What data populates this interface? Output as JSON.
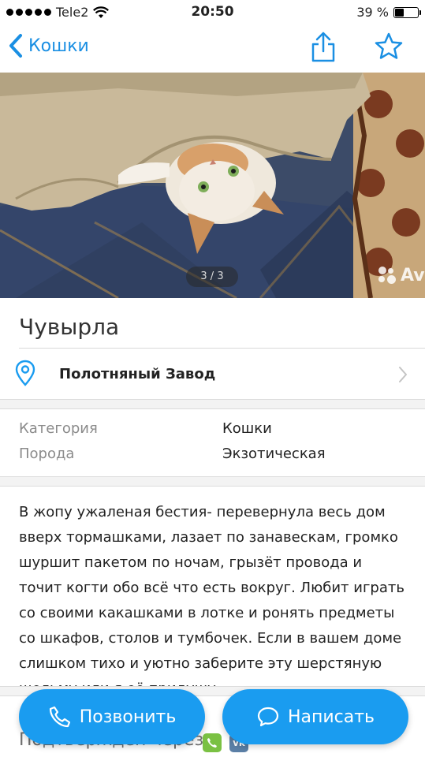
{
  "status_bar": {
    "carrier": "Tele2",
    "time": "20:50",
    "battery": "39 %",
    "battery_level_percent": 39
  },
  "nav": {
    "back_label": "Кошки",
    "icons": [
      "chevron-left-icon",
      "share-icon",
      "star-icon"
    ],
    "accent_color": "#1a8fe3"
  },
  "gallery": {
    "counter": "3 / 3",
    "watermark": "Avi"
  },
  "listing": {
    "title": "Чувырла",
    "location": "Полотняный Завод"
  },
  "params": [
    {
      "key": "Категория",
      "value": "Кошки"
    },
    {
      "key": "Порода",
      "value": "Экзотическая"
    }
  ],
  "description": "В жопу ужаленая бестия- перевернула весь дом вверх тормашками, лазает по занавескам, громко шуршит пакетом по ночам, грызёт провода и точит когти обо всё что есть вокруг. Любит играть со своими какашками в лотке и ронять предметы со шкафов, столов и тумбочек. Если в вашем доме слишком тихо и уютно заберите эту шерстяную шельму или я её придушу.",
  "confirmed": {
    "label": "Подтверждён через",
    "icons": [
      "phone-green-icon",
      "vk-icon"
    ]
  },
  "actions": {
    "call_label": "Позвонить",
    "write_label": "Написать",
    "button_color": "#1a9cf0"
  }
}
